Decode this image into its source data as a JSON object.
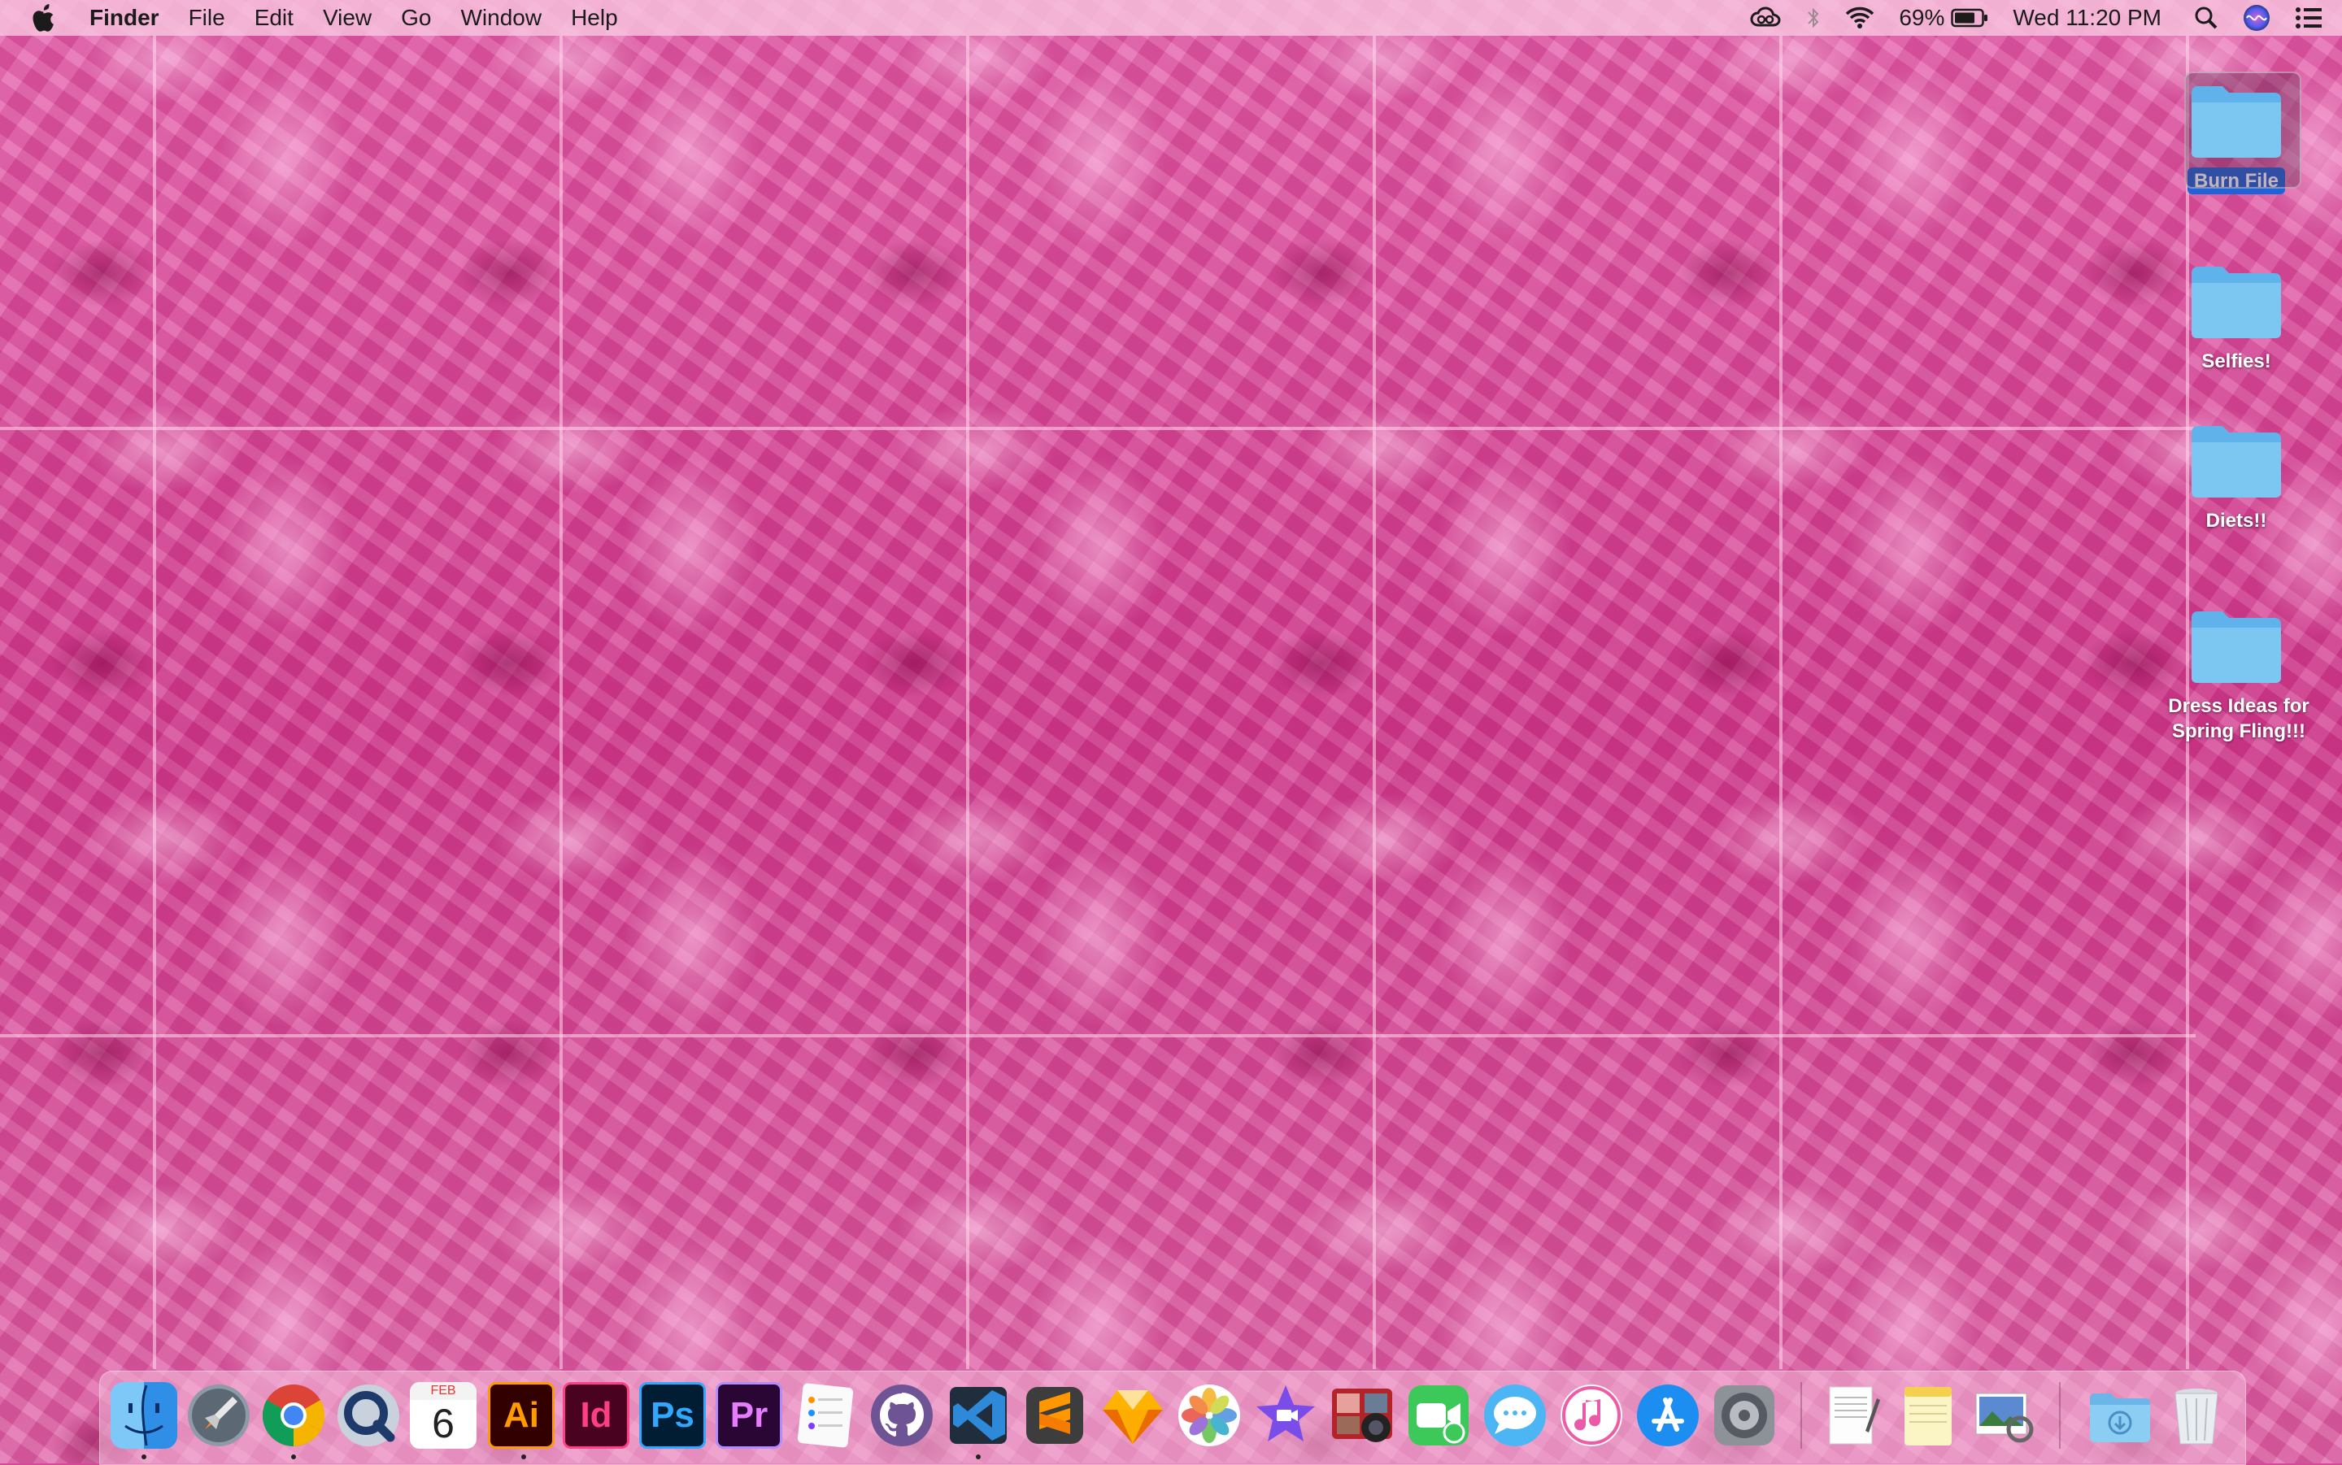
{
  "menubar": {
    "app_name": "Finder",
    "menus": [
      "File",
      "Edit",
      "View",
      "Go",
      "Window",
      "Help"
    ],
    "battery_percent": "69%",
    "clock": "Wed 11:20 PM"
  },
  "desktop": {
    "icons": [
      {
        "label": "Burn File",
        "selected": true
      },
      {
        "label": "Selfies!",
        "selected": false
      },
      {
        "label": "Diets!!",
        "selected": false
      },
      {
        "label": "Dress Ideas for Spring Fling!!!",
        "selected": false
      }
    ]
  },
  "dock": {
    "calendar_month": "FEB",
    "calendar_day": "6",
    "adobe": {
      "illustrator": "Ai",
      "indesign": "Id",
      "photoshop": "Ps",
      "premiere": "Pr"
    }
  },
  "colors": {
    "folder": "#7cc6f2",
    "selection": "#1f63d8",
    "menubar": "#f8c4de"
  }
}
